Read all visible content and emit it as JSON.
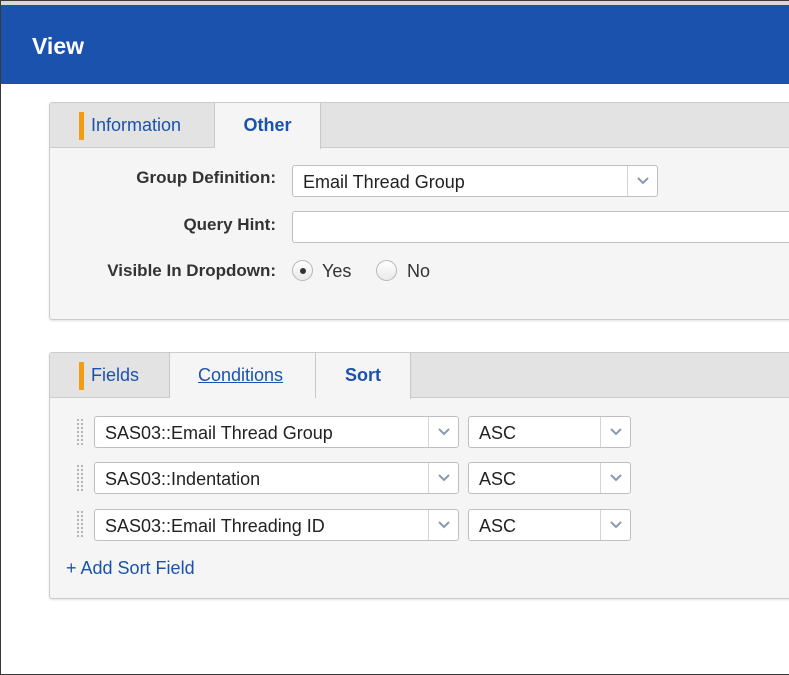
{
  "header": {
    "title": "View"
  },
  "info_panel": {
    "tabs": [
      {
        "label": "Information"
      },
      {
        "label": "Other"
      }
    ],
    "group_definition": {
      "label": "Group Definition:",
      "value": "Email Thread Group"
    },
    "query_hint": {
      "label": "Query Hint:",
      "value": ""
    },
    "visible_in_dropdown": {
      "label": "Visible In Dropdown:",
      "options": [
        {
          "label": "Yes",
          "checked": true
        },
        {
          "label": "No",
          "checked": false
        }
      ]
    }
  },
  "fields_panel": {
    "tabs": [
      {
        "label": "Fields"
      },
      {
        "label": "Conditions"
      },
      {
        "label": "Sort"
      }
    ],
    "sort_rows": [
      {
        "field": "SAS03::Email Thread Group",
        "order": "ASC"
      },
      {
        "field": "SAS03::Indentation",
        "order": "ASC"
      },
      {
        "field": "SAS03::Email Threading ID",
        "order": "ASC"
      }
    ],
    "add_sort_field": "+ Add Sort Field"
  },
  "icons": {
    "caret": "chevron-down-icon",
    "grip": "drag-handle-icon"
  },
  "colors": {
    "header": "#1b52ad",
    "accent": "#f39c12",
    "link": "#1b52ad"
  }
}
